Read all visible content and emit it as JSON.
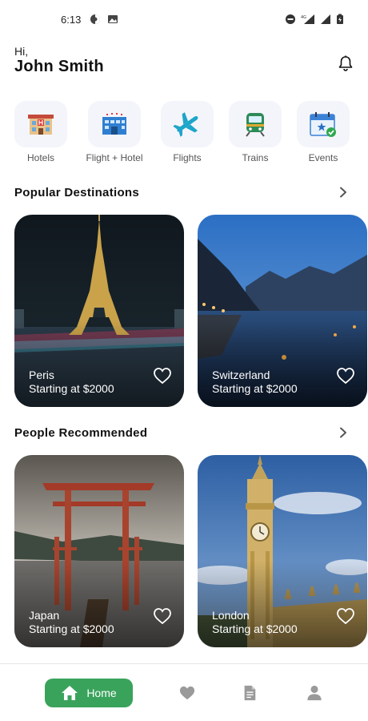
{
  "status_bar": {
    "time": "6:13",
    "network": "4G"
  },
  "header": {
    "greeting": "Hi,",
    "user_name": "John Smith"
  },
  "categories": [
    {
      "label": "Hotels",
      "icon": "hotel-icon"
    },
    {
      "label": "Flight + Hotel",
      "icon": "flight-hotel-icon"
    },
    {
      "label": "Flights",
      "icon": "airplane-icon"
    },
    {
      "label": "Trains",
      "icon": "train-icon"
    },
    {
      "label": "Events",
      "icon": "calendar-event-icon"
    }
  ],
  "popular": {
    "title": "Popular Destinations",
    "cards": [
      {
        "name": "Peris",
        "price": "Starting at $2000"
      },
      {
        "name": "Switzerland",
        "price": "Starting at $2000"
      }
    ]
  },
  "recommended": {
    "title": "People Recommended",
    "cards": [
      {
        "name": "Japan",
        "price": "Starting at $2000"
      },
      {
        "name": "London",
        "price": "Starting at $2000"
      }
    ]
  },
  "bottom_nav": {
    "home_label": "Home"
  },
  "colors": {
    "accent": "#3aa35b",
    "tile_bg": "#f4f5fb",
    "text": "#111111"
  }
}
